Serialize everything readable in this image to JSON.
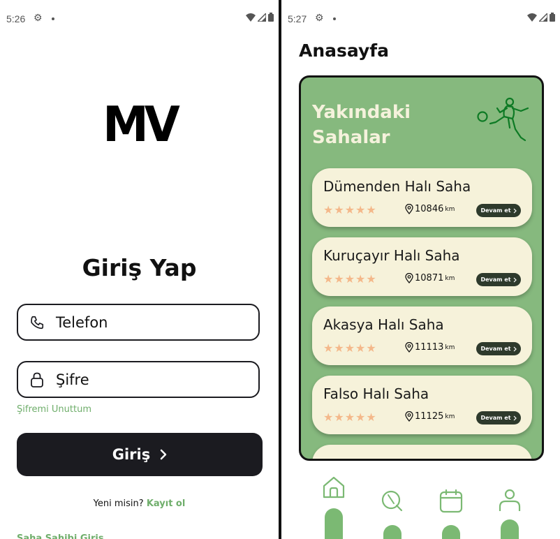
{
  "login": {
    "status": {
      "time": "5:26"
    },
    "logo": "MV",
    "title": "Giriş Yap",
    "phone_placeholder": "Telefon",
    "password_placeholder": "Şifre",
    "forgot": "Şifremi Unuttum",
    "login_button": "Giriş",
    "signup_prompt": "Yeni misin?",
    "signup_link": "Kayıt ol",
    "owner_login": "Saha Sahibi Giriş"
  },
  "home": {
    "status": {
      "time": "5:27"
    },
    "title": "Anasayfa",
    "panel_title_line1": "Yakındaki",
    "panel_title_line2": "Sahalar",
    "venues": [
      {
        "name": "Dümenden Halı Saha",
        "rating": 5,
        "stars": "★★★★★",
        "distance": "10846",
        "unit": "km",
        "action": "Devam et"
      },
      {
        "name": "Kuruçayır Halı Saha",
        "rating": 5,
        "stars": "★★★★★",
        "distance": "10871",
        "unit": "km",
        "action": "Devam et"
      },
      {
        "name": "Akasya Halı Saha",
        "rating": 5,
        "stars": "★★★★★",
        "distance": "11113",
        "unit": "km",
        "action": "Devam et"
      },
      {
        "name": "Falso Halı Saha",
        "rating": 5,
        "stars": "★★★★★",
        "distance": "11125",
        "unit": "km",
        "action": "Devam et"
      }
    ],
    "nav": [
      "home-icon",
      "search-icon",
      "calendar-icon",
      "profile-icon"
    ]
  },
  "colors": {
    "accent_green": "#7bb973",
    "panel_green": "#86b97e",
    "card_cream": "#f6f2da",
    "dark": "#1b1b20",
    "star": "#f4b88a"
  }
}
